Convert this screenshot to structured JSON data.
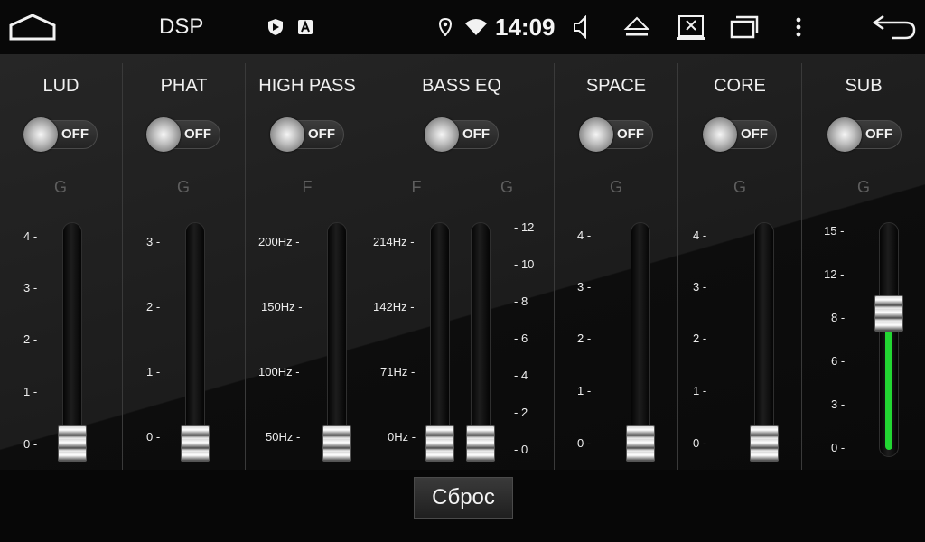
{
  "statusbar": {
    "title": "DSP",
    "time": "14:09",
    "icons": [
      "home-icon",
      "shield-icon",
      "a-badge-icon",
      "location-icon",
      "wifi-icon",
      "volume-icon",
      "eject-icon",
      "screen-off-icon",
      "recent-apps-icon",
      "more-vert-icon",
      "back-icon"
    ]
  },
  "panels": [
    {
      "title": "LUD",
      "toggle": "OFF",
      "letter": "G",
      "ticks": [
        "4 -",
        "3 -",
        "2 -",
        "1 -",
        "0 -"
      ],
      "value": 0,
      "max": 4
    },
    {
      "title": "PHAT",
      "toggle": "OFF",
      "letter": "G",
      "ticks": [
        "3 -",
        "2 -",
        "1 -",
        "0 -"
      ],
      "value": 0,
      "max": 3
    },
    {
      "title": "HIGH PASS",
      "toggle": "OFF",
      "letter": "F",
      "ticks": [
        "200Hz -",
        "150Hz -",
        "100Hz -",
        "50Hz -"
      ],
      "value": "50Hz"
    },
    {
      "title": "BASS EQ",
      "toggle": "OFF",
      "letters": [
        "F",
        "G"
      ],
      "ticks_left": [
        "214Hz -",
        "142Hz -",
        "71Hz -",
        "0Hz -"
      ],
      "ticks_right": [
        "- 12",
        "- 10",
        "- 8",
        "- 6",
        "- 4",
        "- 2",
        "- 0"
      ],
      "freq_value": "0Hz",
      "gain_value": 0
    },
    {
      "title": "SPACE",
      "toggle": "OFF",
      "letter": "G",
      "ticks": [
        "4 -",
        "3 -",
        "2 -",
        "1 -",
        "0 -"
      ],
      "value": 0,
      "max": 4
    },
    {
      "title": "CORE",
      "toggle": "OFF",
      "letter": "G",
      "ticks": [
        "4 -",
        "3 -",
        "2 -",
        "1 -",
        "0 -"
      ],
      "value": 0,
      "max": 4
    },
    {
      "title": "SUB",
      "toggle": "OFF",
      "letter": "G",
      "ticks": [
        "15 -",
        "12 -",
        "8 -",
        "6 -",
        "3 -",
        "0 -"
      ],
      "value": 8,
      "max": 15
    }
  ],
  "reset_label": "Сброс",
  "colors": {
    "accent_fill": "#22d632",
    "background": "#0c0c0c"
  }
}
